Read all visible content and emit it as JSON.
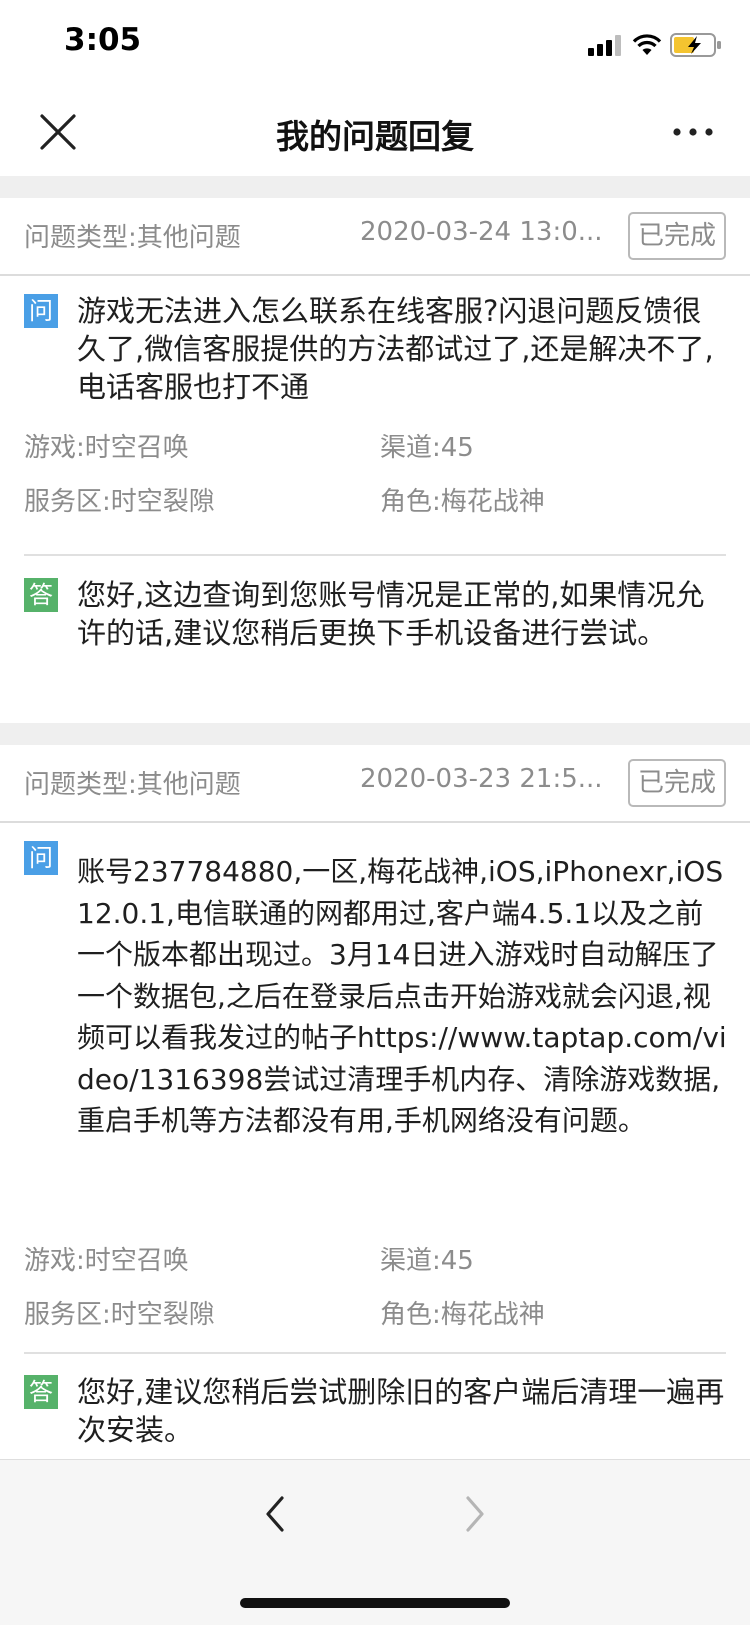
{
  "status_bar": {
    "time": "3:05"
  },
  "nav": {
    "title": "我的问题回复"
  },
  "tickets": [
    {
      "type_label": "问题类型:",
      "type_value": "其他问题",
      "date": "2020-03-24 13:0...",
      "status": "已完成",
      "question_tag": "问",
      "question": "游戏无法进入怎么联系在线客服?闪退问题反馈很久了,微信客服提供的方法都试过了,还是解决不了,电话客服也打不通",
      "game": "游戏:时空召唤",
      "channel": "渠道:45",
      "server": "服务区:时空裂隙",
      "role": "角色:梅花战神",
      "answer_tag": "答",
      "answer": "您好,这边查询到您账号情况是正常的,如果情况允许的话,建议您稍后更换下手机设备进行尝试。"
    },
    {
      "type_label": "问题类型:",
      "type_value": "其他问题",
      "date": "2020-03-23 21:5...",
      "status": "已完成",
      "question_tag": "问",
      "question": "账号237784880,一区,梅花战神,iOS,iPhonexr,iOS12.0.1,电信联通的网都用过,客户端4.5.1以及之前一个版本都出现过。3月14日进入游戏时自动解压了一个数据包,之后在登录后点击开始游戏就会闪退,视频可以看我发过的帖子https://www.taptap.com/video/1316398尝试过清理手机内存、清除游戏数据,重启手机等方法都没有用,手机网络没有问题。",
      "game": "游戏:时空召唤",
      "channel": "渠道:45",
      "server": "服务区:时空裂隙",
      "role": "角色:梅花战神",
      "answer_tag": "答",
      "answer": "您好,建议您稍后尝试删除旧的客户端后清理一遍再次安装。"
    }
  ],
  "icons": {
    "close": "close-icon",
    "more": "more-icon",
    "back": "chevron-left-icon",
    "forward": "chevron-right-icon"
  },
  "colors": {
    "question_tag": "#4a9fe6",
    "answer_tag": "#56b26a",
    "page_background": "#efefef"
  }
}
